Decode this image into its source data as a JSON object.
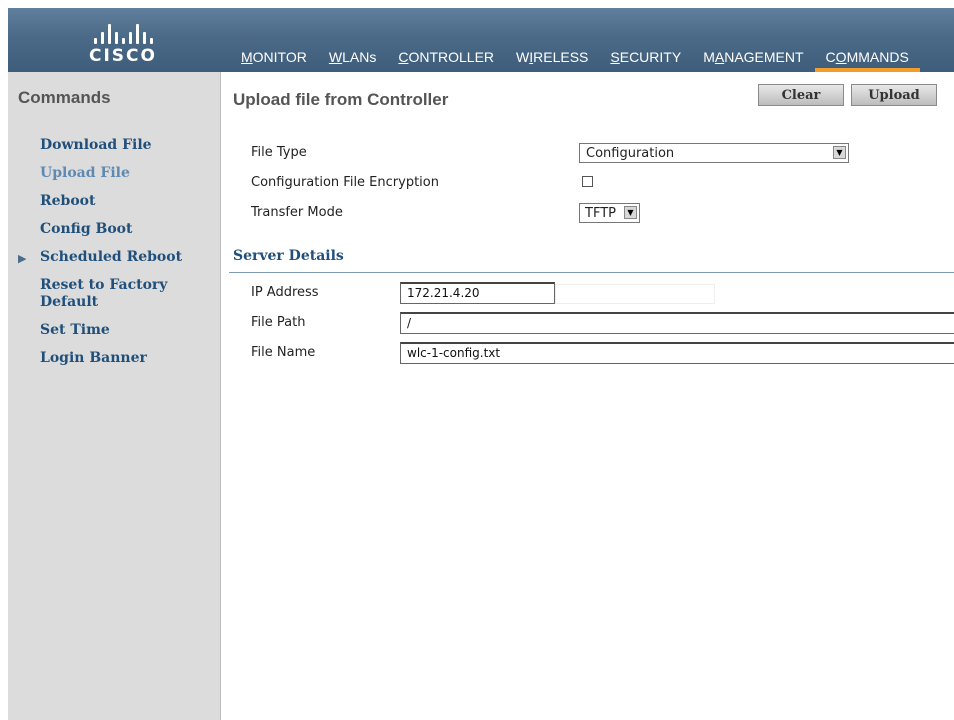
{
  "brand": {
    "logo_text": "CISCO"
  },
  "nav": [
    {
      "pre": "",
      "ul": "M",
      "post": "ONITOR"
    },
    {
      "pre": "",
      "ul": "W",
      "post": "LANs"
    },
    {
      "pre": "",
      "ul": "C",
      "post": "ONTROLLER"
    },
    {
      "pre": "W",
      "ul": "I",
      "post": "RELESS"
    },
    {
      "pre": "",
      "ul": "S",
      "post": "ECURITY"
    },
    {
      "pre": "M",
      "ul": "A",
      "post": "NAGEMENT"
    },
    {
      "pre": "C",
      "ul": "O",
      "post": "MMANDS"
    }
  ],
  "sidebar": {
    "title": "Commands",
    "items": [
      {
        "label": "Download File"
      },
      {
        "label": "Upload File"
      },
      {
        "label": "Reboot"
      },
      {
        "label": "Config Boot"
      },
      {
        "label": "Scheduled Reboot"
      },
      {
        "label": "Reset to Factory Default"
      },
      {
        "label": "Set Time"
      },
      {
        "label": "Login Banner"
      }
    ]
  },
  "page": {
    "title": "Upload file from Controller",
    "clear_label": "Clear",
    "upload_label": "Upload"
  },
  "form": {
    "file_type_label": "File Type",
    "file_type_value": "Configuration",
    "encryption_label": "Configuration File Encryption",
    "transfer_mode_label": "Transfer Mode",
    "transfer_mode_value": "TFTP"
  },
  "server": {
    "title": "Server Details",
    "ip_label": "IP Address",
    "ip_value": "172.21.4.20",
    "path_label": "File Path",
    "path_value": "/",
    "name_label": "File Name",
    "name_value": "wlc-1-config.txt"
  },
  "colors": {
    "header": "#4b6a88",
    "active_tab": "#f29c2a",
    "link": "#1f4f7a",
    "sidebar_bg": "#dcdcdc"
  },
  "icons": {
    "dropdown": "triangle-down-icon",
    "submenu": "triangle-right-icon"
  }
}
